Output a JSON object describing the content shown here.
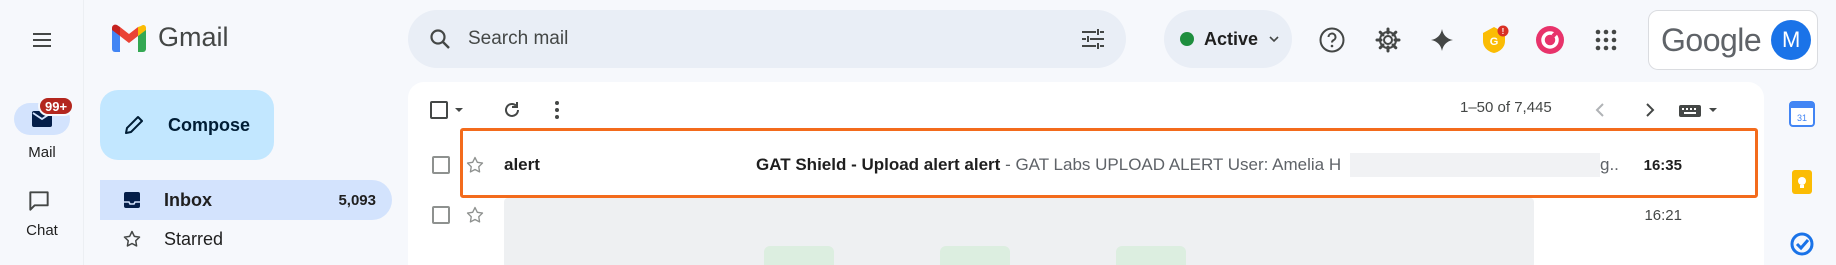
{
  "brand": {
    "name": "Gmail"
  },
  "rail": {
    "mail_label": "Mail",
    "mail_badge": "99+",
    "chat_label": "Chat"
  },
  "compose": {
    "label": "Compose"
  },
  "nav": {
    "inbox": {
      "label": "Inbox",
      "count": "5,093"
    },
    "starred": {
      "label": "Starred"
    }
  },
  "search": {
    "placeholder": "Search mail",
    "value": ""
  },
  "status": {
    "label": "Active",
    "color": "#1e8e3e"
  },
  "account": {
    "wordmark": "Google",
    "initial": "M",
    "avatar_color": "#1a73e8"
  },
  "toolbar": {
    "range": "1–50 of 7,445"
  },
  "emails": [
    {
      "sender": "alert",
      "subject": "GAT Shield - Upload alert alert",
      "snippet": " - GAT Labs UPLOAD ALERT User: Amelia H",
      "trail": "g..",
      "time": "16:35",
      "unread": true
    },
    {
      "sender": "",
      "subject": "",
      "snippet": "",
      "time": "16:21",
      "unread": false
    }
  ],
  "colors": {
    "highlight": "#f36b1c",
    "compose_bg": "#c2e7ff",
    "selected_nav_bg": "#d3e3fd",
    "badge_red": "#b3261e"
  },
  "icons": {
    "menu": "menu-icon",
    "mail": "mail-icon",
    "chat": "chat-icon",
    "pencil": "pencil-icon",
    "inbox": "inbox-icon",
    "star": "star-icon",
    "search": "search-icon",
    "filters": "filter-sliders-icon",
    "help": "help-icon",
    "settings": "gear-icon",
    "gemini": "sparkle-icon",
    "refresh": "refresh-icon",
    "more": "more-vert-icon",
    "prev": "chevron-left-icon",
    "next": "chevron-right-icon",
    "keyboard": "keyboard-icon"
  }
}
